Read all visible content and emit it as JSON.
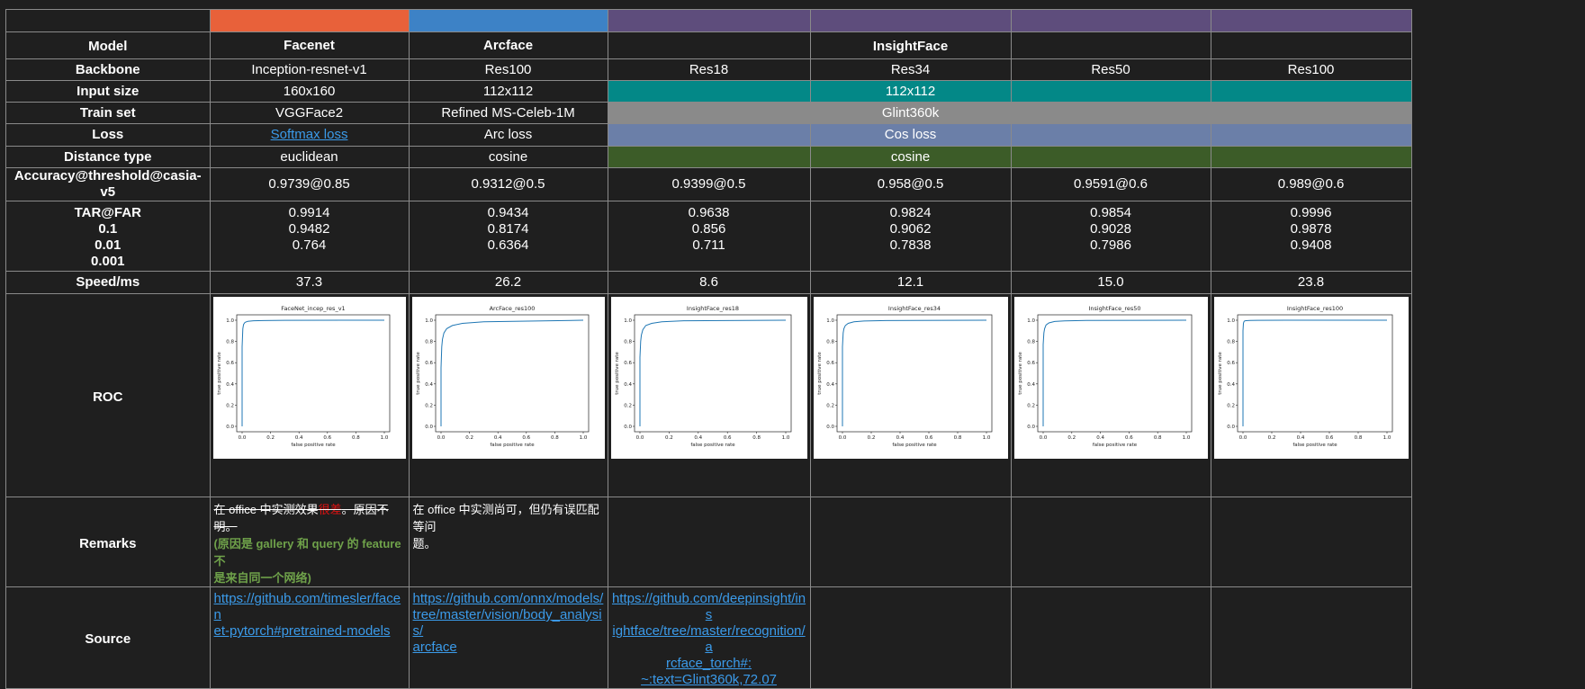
{
  "row_labels": {
    "model": "Model",
    "backbone": "Backbone",
    "input_size": "Input size",
    "train_set": "Train set",
    "loss": "Loss",
    "distance_type": "Distance type",
    "accuracy": "Accuracy@threshold@casia-v5",
    "tar_far": [
      "TAR@FAR",
      "0.1",
      "0.01",
      "0.001"
    ],
    "speed": "Speed/ms",
    "roc": "ROC",
    "remarks": "Remarks",
    "source": "Source"
  },
  "colors": {
    "facenet": "#e8613a",
    "arcface": "#3d82c6",
    "insightface": "#5e4d7c",
    "input_size": "#038887",
    "train_set": "#8a8a8a",
    "loss": "#6b7fa8",
    "distance": "#3c5c28",
    "link": "#3b9bea"
  },
  "models": {
    "facenet": "Facenet",
    "arcface": "Arcface",
    "insightface": "InsightFace"
  },
  "backbones": [
    "Inception-resnet-v1",
    "Res100",
    "Res18",
    "Res34",
    "Res50",
    "Res100"
  ],
  "input_size": {
    "facenet": "160x160",
    "arcface": "112x112",
    "insightface": "112x112"
  },
  "train_set": {
    "facenet": "VGGFace2",
    "arcface": "Refined MS-Celeb-1M",
    "insightface": "Glint360k"
  },
  "loss": {
    "facenet": "Softmax loss",
    "arcface": "Arc loss",
    "insightface": "Cos loss"
  },
  "distance": {
    "facenet": "euclidean",
    "arcface": "cosine",
    "insightface": "cosine"
  },
  "accuracy": [
    "0.9739@0.85",
    "0.9312@0.5",
    "0.9399@0.5",
    "0.958@0.5",
    "0.9591@0.6",
    "0.989@0.6"
  ],
  "tar": [
    [
      "0.9914",
      "0.9482",
      "0.764"
    ],
    [
      "0.9434",
      "0.8174",
      "0.6364"
    ],
    [
      "0.9638",
      "0.856",
      "0.711"
    ],
    [
      "0.9824",
      "0.9062",
      "0.7838"
    ],
    [
      "0.9854",
      "0.9028",
      "0.7986"
    ],
    [
      "0.9996",
      "0.9878",
      "0.9408"
    ]
  ],
  "speed": [
    "37.3",
    "26.2",
    "8.6",
    "12.1",
    "15.0",
    "23.8"
  ],
  "roc_titles": [
    "FaceNet_incep_res_v1",
    "ArcFace_res100",
    "InsightFace_res18",
    "InsightFace_res34",
    "InsightFace_res50",
    "InsightFace_res100"
  ],
  "roc_axes": {
    "xlabel": "false positive rate",
    "ylabel": "true positive rate",
    "ticks": [
      "0.0",
      "0.2",
      "0.4",
      "0.6",
      "0.8",
      "1.0"
    ]
  },
  "chart_data": [
    {
      "type": "line",
      "title": "FaceNet_incep_res_v1",
      "xlabel": "false positive rate",
      "ylabel": "true positive rate",
      "xlim": [
        0,
        1
      ],
      "ylim": [
        0,
        1
      ],
      "x": [
        0,
        0.0,
        0.005,
        0.01,
        0.02,
        0.04,
        0.08,
        0.15,
        0.3,
        1.0
      ],
      "y": [
        0,
        0.75,
        0.92,
        0.96,
        0.98,
        0.99,
        0.995,
        0.997,
        0.999,
        1.0
      ]
    },
    {
      "type": "line",
      "title": "ArcFace_res100",
      "xlabel": "false positive rate",
      "ylabel": "true positive rate",
      "xlim": [
        0,
        1
      ],
      "ylim": [
        0,
        1
      ],
      "x": [
        0,
        0.0,
        0.005,
        0.01,
        0.02,
        0.04,
        0.08,
        0.15,
        0.3,
        1.0
      ],
      "y": [
        0,
        0.55,
        0.75,
        0.82,
        0.88,
        0.92,
        0.95,
        0.97,
        0.985,
        1.0
      ]
    },
    {
      "type": "line",
      "title": "InsightFace_res18",
      "xlabel": "false positive rate",
      "ylabel": "true positive rate",
      "xlim": [
        0,
        1
      ],
      "ylim": [
        0,
        1
      ],
      "x": [
        0,
        0.0,
        0.005,
        0.01,
        0.02,
        0.04,
        0.08,
        0.15,
        0.3,
        1.0
      ],
      "y": [
        0,
        0.65,
        0.8,
        0.86,
        0.91,
        0.95,
        0.97,
        0.985,
        0.995,
        1.0
      ]
    },
    {
      "type": "line",
      "title": "InsightFace_res34",
      "xlabel": "false positive rate",
      "ylabel": "true positive rate",
      "xlim": [
        0,
        1
      ],
      "ylim": [
        0,
        1
      ],
      "x": [
        0,
        0.0,
        0.005,
        0.01,
        0.02,
        0.04,
        0.08,
        0.15,
        0.3,
        1.0
      ],
      "y": [
        0,
        0.75,
        0.88,
        0.92,
        0.95,
        0.97,
        0.985,
        0.992,
        0.997,
        1.0
      ]
    },
    {
      "type": "line",
      "title": "InsightFace_res50",
      "xlabel": "false positive rate",
      "ylabel": "true positive rate",
      "xlim": [
        0,
        1
      ],
      "ylim": [
        0,
        1
      ],
      "x": [
        0,
        0.0,
        0.005,
        0.01,
        0.02,
        0.04,
        0.08,
        0.15,
        0.3,
        1.0
      ],
      "y": [
        0,
        0.77,
        0.88,
        0.92,
        0.955,
        0.975,
        0.988,
        0.994,
        0.998,
        1.0
      ]
    },
    {
      "type": "line",
      "title": "InsightFace_res100",
      "xlabel": "false positive rate",
      "ylabel": "true positive rate",
      "xlim": [
        0,
        1
      ],
      "ylim": [
        0,
        1
      ],
      "x": [
        0,
        0.0,
        0.003,
        0.006,
        0.01,
        0.02,
        0.05,
        0.1,
        0.3,
        1.0
      ],
      "y": [
        0,
        0.9,
        0.97,
        0.985,
        0.992,
        0.996,
        0.998,
        0.999,
        1.0,
        1.0
      ]
    }
  ],
  "remarks": {
    "facenet_strike_a": "在 office 中实测效果",
    "facenet_strike_red": "很差",
    "facenet_strike_b": "。原因不明。",
    "facenet_note_1": "(原因是 gallery 和  query 的 feature 不",
    "facenet_note_2": "是来自同一个网络)",
    "arcface_1": "在 office 中实测尚可，但仍有误匹配等问",
    "arcface_2": "题。"
  },
  "sources": {
    "facenet": [
      "https://github.com/timesler/facen",
      "et-pytorch#pretrained-models"
    ],
    "arcface": [
      "https://github.com/onnx/models/",
      "tree/master/vision/body_analysis/",
      "arcface"
    ],
    "insightface": [
      "https://github.com/deepinsight/ins",
      "ightface/tree/master/recognition/a",
      "rcface_torch#:",
      "~:text=Glint360k,72.07"
    ]
  }
}
